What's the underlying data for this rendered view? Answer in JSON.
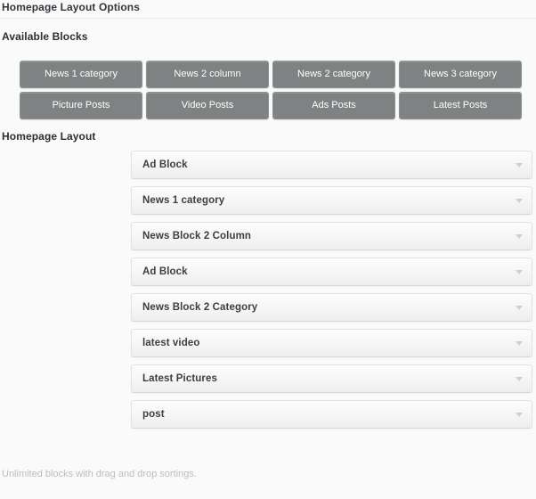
{
  "header": {
    "title": "Homepage Layout Options"
  },
  "available_blocks": {
    "label": "Available Blocks",
    "buttons": [
      {
        "label": "News 1 category"
      },
      {
        "label": "News 2 column"
      },
      {
        "label": "News 2 category"
      },
      {
        "label": "News 3 category"
      },
      {
        "label": "Picture Posts"
      },
      {
        "label": "Video Posts"
      },
      {
        "label": "Ads Posts"
      },
      {
        "label": "Latest Posts"
      }
    ],
    "button_color": "#7e8282",
    "button_text_color": "#ffffff"
  },
  "homepage_layout": {
    "label": "Homepage Layout",
    "rows": [
      {
        "label": "Ad Block",
        "caret": "chevron-down-icon"
      },
      {
        "label": "News 1 category",
        "caret": "chevron-down-icon"
      },
      {
        "label": "News Block 2 Column",
        "caret": "chevron-down-icon"
      },
      {
        "label": "Ad Block",
        "caret": "chevron-down-icon"
      },
      {
        "label": "News Block 2 Category",
        "caret": "chevron-down-icon"
      },
      {
        "label": "latest video",
        "caret": "chevron-down-icon"
      },
      {
        "label": "Latest Pictures",
        "caret": "chevron-down-icon"
      },
      {
        "label": "post",
        "caret": "chevron-down-icon"
      }
    ]
  },
  "footer": {
    "note": "Unlimited blocks with drag and drop sortings."
  }
}
